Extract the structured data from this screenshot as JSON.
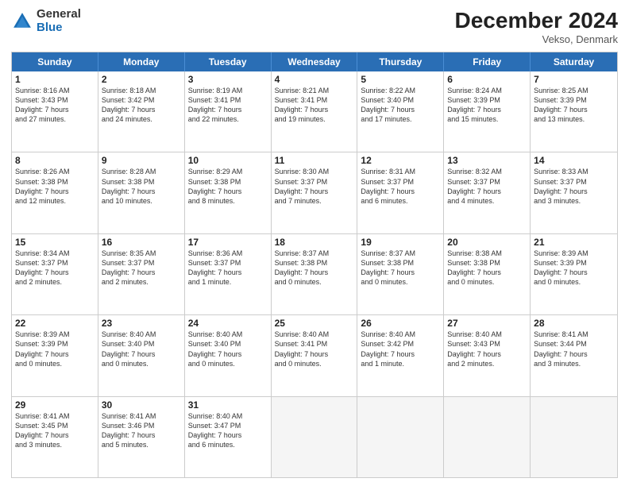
{
  "header": {
    "logo_general": "General",
    "logo_blue": "Blue",
    "month_title": "December 2024",
    "location": "Vekso, Denmark"
  },
  "days_of_week": [
    "Sunday",
    "Monday",
    "Tuesday",
    "Wednesday",
    "Thursday",
    "Friday",
    "Saturday"
  ],
  "weeks": [
    [
      {
        "day": "1",
        "lines": [
          "Sunrise: 8:16 AM",
          "Sunset: 3:43 PM",
          "Daylight: 7 hours",
          "and 27 minutes."
        ]
      },
      {
        "day": "2",
        "lines": [
          "Sunrise: 8:18 AM",
          "Sunset: 3:42 PM",
          "Daylight: 7 hours",
          "and 24 minutes."
        ]
      },
      {
        "day": "3",
        "lines": [
          "Sunrise: 8:19 AM",
          "Sunset: 3:41 PM",
          "Daylight: 7 hours",
          "and 22 minutes."
        ]
      },
      {
        "day": "4",
        "lines": [
          "Sunrise: 8:21 AM",
          "Sunset: 3:41 PM",
          "Daylight: 7 hours",
          "and 19 minutes."
        ]
      },
      {
        "day": "5",
        "lines": [
          "Sunrise: 8:22 AM",
          "Sunset: 3:40 PM",
          "Daylight: 7 hours",
          "and 17 minutes."
        ]
      },
      {
        "day": "6",
        "lines": [
          "Sunrise: 8:24 AM",
          "Sunset: 3:39 PM",
          "Daylight: 7 hours",
          "and 15 minutes."
        ]
      },
      {
        "day": "7",
        "lines": [
          "Sunrise: 8:25 AM",
          "Sunset: 3:39 PM",
          "Daylight: 7 hours",
          "and 13 minutes."
        ]
      }
    ],
    [
      {
        "day": "8",
        "lines": [
          "Sunrise: 8:26 AM",
          "Sunset: 3:38 PM",
          "Daylight: 7 hours",
          "and 12 minutes."
        ]
      },
      {
        "day": "9",
        "lines": [
          "Sunrise: 8:28 AM",
          "Sunset: 3:38 PM",
          "Daylight: 7 hours",
          "and 10 minutes."
        ]
      },
      {
        "day": "10",
        "lines": [
          "Sunrise: 8:29 AM",
          "Sunset: 3:38 PM",
          "Daylight: 7 hours",
          "and 8 minutes."
        ]
      },
      {
        "day": "11",
        "lines": [
          "Sunrise: 8:30 AM",
          "Sunset: 3:37 PM",
          "Daylight: 7 hours",
          "and 7 minutes."
        ]
      },
      {
        "day": "12",
        "lines": [
          "Sunrise: 8:31 AM",
          "Sunset: 3:37 PM",
          "Daylight: 7 hours",
          "and 6 minutes."
        ]
      },
      {
        "day": "13",
        "lines": [
          "Sunrise: 8:32 AM",
          "Sunset: 3:37 PM",
          "Daylight: 7 hours",
          "and 4 minutes."
        ]
      },
      {
        "day": "14",
        "lines": [
          "Sunrise: 8:33 AM",
          "Sunset: 3:37 PM",
          "Daylight: 7 hours",
          "and 3 minutes."
        ]
      }
    ],
    [
      {
        "day": "15",
        "lines": [
          "Sunrise: 8:34 AM",
          "Sunset: 3:37 PM",
          "Daylight: 7 hours",
          "and 2 minutes."
        ]
      },
      {
        "day": "16",
        "lines": [
          "Sunrise: 8:35 AM",
          "Sunset: 3:37 PM",
          "Daylight: 7 hours",
          "and 2 minutes."
        ]
      },
      {
        "day": "17",
        "lines": [
          "Sunrise: 8:36 AM",
          "Sunset: 3:37 PM",
          "Daylight: 7 hours",
          "and 1 minute."
        ]
      },
      {
        "day": "18",
        "lines": [
          "Sunrise: 8:37 AM",
          "Sunset: 3:38 PM",
          "Daylight: 7 hours",
          "and 0 minutes."
        ]
      },
      {
        "day": "19",
        "lines": [
          "Sunrise: 8:37 AM",
          "Sunset: 3:38 PM",
          "Daylight: 7 hours",
          "and 0 minutes."
        ]
      },
      {
        "day": "20",
        "lines": [
          "Sunrise: 8:38 AM",
          "Sunset: 3:38 PM",
          "Daylight: 7 hours",
          "and 0 minutes."
        ]
      },
      {
        "day": "21",
        "lines": [
          "Sunrise: 8:39 AM",
          "Sunset: 3:39 PM",
          "Daylight: 7 hours",
          "and 0 minutes."
        ]
      }
    ],
    [
      {
        "day": "22",
        "lines": [
          "Sunrise: 8:39 AM",
          "Sunset: 3:39 PM",
          "Daylight: 7 hours",
          "and 0 minutes."
        ]
      },
      {
        "day": "23",
        "lines": [
          "Sunrise: 8:40 AM",
          "Sunset: 3:40 PM",
          "Daylight: 7 hours",
          "and 0 minutes."
        ]
      },
      {
        "day": "24",
        "lines": [
          "Sunrise: 8:40 AM",
          "Sunset: 3:40 PM",
          "Daylight: 7 hours",
          "and 0 minutes."
        ]
      },
      {
        "day": "25",
        "lines": [
          "Sunrise: 8:40 AM",
          "Sunset: 3:41 PM",
          "Daylight: 7 hours",
          "and 0 minutes."
        ]
      },
      {
        "day": "26",
        "lines": [
          "Sunrise: 8:40 AM",
          "Sunset: 3:42 PM",
          "Daylight: 7 hours",
          "and 1 minute."
        ]
      },
      {
        "day": "27",
        "lines": [
          "Sunrise: 8:40 AM",
          "Sunset: 3:43 PM",
          "Daylight: 7 hours",
          "and 2 minutes."
        ]
      },
      {
        "day": "28",
        "lines": [
          "Sunrise: 8:41 AM",
          "Sunset: 3:44 PM",
          "Daylight: 7 hours",
          "and 3 minutes."
        ]
      }
    ],
    [
      {
        "day": "29",
        "lines": [
          "Sunrise: 8:41 AM",
          "Sunset: 3:45 PM",
          "Daylight: 7 hours",
          "and 3 minutes."
        ]
      },
      {
        "day": "30",
        "lines": [
          "Sunrise: 8:41 AM",
          "Sunset: 3:46 PM",
          "Daylight: 7 hours",
          "and 5 minutes."
        ]
      },
      {
        "day": "31",
        "lines": [
          "Sunrise: 8:40 AM",
          "Sunset: 3:47 PM",
          "Daylight: 7 hours",
          "and 6 minutes."
        ]
      },
      {
        "day": "",
        "lines": []
      },
      {
        "day": "",
        "lines": []
      },
      {
        "day": "",
        "lines": []
      },
      {
        "day": "",
        "lines": []
      }
    ]
  ]
}
